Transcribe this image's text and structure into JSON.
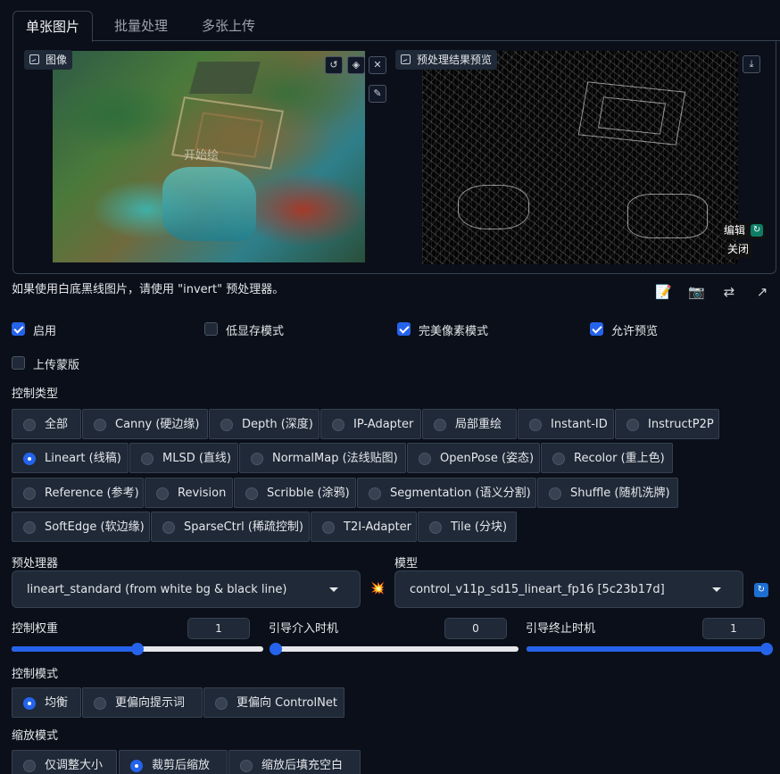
{
  "tabs": [
    {
      "label": "单张图片",
      "active": true
    },
    {
      "label": "批量处理",
      "active": false
    },
    {
      "label": "多张上传",
      "active": false
    }
  ],
  "image_panel": {
    "label": "图像",
    "watermark": "开始绘",
    "buttons": {
      "reset": "↺",
      "erase": "◈",
      "close": "✕",
      "brush": "✎"
    }
  },
  "preview_panel": {
    "label": "预处理结果预览",
    "download": "⤓",
    "edit_label": "编辑",
    "close_label": "关闭"
  },
  "notice": "如果使用白底黑线图片，请使用 \"invert\" 预处理器。",
  "tool_icons": [
    "📝",
    "📷",
    "⇄",
    "↗"
  ],
  "checkboxes": [
    {
      "label": "启用",
      "checked": true
    },
    {
      "label": "低显存模式",
      "checked": false
    },
    {
      "label": "完美像素模式",
      "checked": true
    },
    {
      "label": "允许预览",
      "checked": true
    },
    {
      "label": "上传蒙版",
      "checked": false
    }
  ],
  "control_type": {
    "label": "控制类型",
    "options": [
      "全部",
      "Canny (硬边缘)",
      "Depth (深度)",
      "IP-Adapter",
      "局部重绘",
      "Instant-ID",
      "InstructP2P",
      "Lineart (线稿)",
      "MLSD (直线)",
      "NormalMap (法线贴图)",
      "OpenPose (姿态)",
      "Recolor (重上色)",
      "Reference (参考)",
      "Revision",
      "Scribble (涂鸦)",
      "Segmentation (语义分割)",
      "Shuffle (随机洗牌)",
      "SoftEdge (软边缘)",
      "SparseCtrl (稀疏控制)",
      "T2I-Adapter",
      "Tile (分块)"
    ],
    "selected": "Lineart (线稿)"
  },
  "preprocessor": {
    "label": "预处理器",
    "value": "lineart_standard (from white bg & black line)",
    "run_icon": "💥"
  },
  "model": {
    "label": "模型",
    "value": "control_v11p_sd15_lineart_fp16 [5c23b17d]",
    "refresh_icon": "🔄"
  },
  "sliders": [
    {
      "label": "控制权重",
      "value": "1",
      "fraction": 0.5
    },
    {
      "label": "引导介入时机",
      "value": "0",
      "fraction": 0
    },
    {
      "label": "引导终止时机",
      "value": "1",
      "fraction": 1
    }
  ],
  "control_mode": {
    "label": "控制模式",
    "options": [
      "均衡",
      "更偏向提示词",
      "更偏向 ControlNet"
    ],
    "selected": "均衡"
  },
  "resize_mode": {
    "label": "缩放模式",
    "options": [
      "仅调整大小",
      "裁剪后缩放",
      "缩放后填充空白"
    ],
    "selected": "裁剪后缩放"
  },
  "colors": {
    "accent": "#2563eb",
    "background": "#0b0f19",
    "panel": "#1f2937",
    "border": "#374151"
  }
}
